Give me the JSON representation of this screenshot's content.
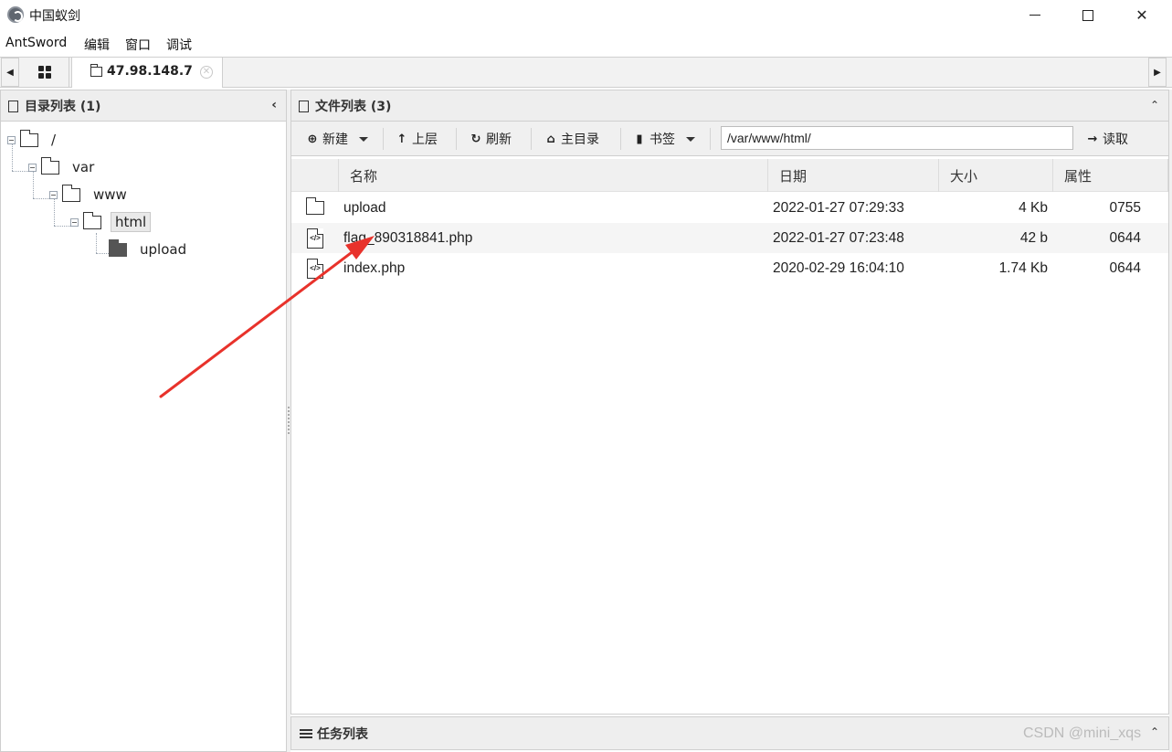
{
  "window": {
    "title": "中国蚁剑",
    "min_glyph": "",
    "close_glyph": "✕"
  },
  "menu": {
    "items": [
      "AntSword",
      "编辑",
      "窗口",
      "调试"
    ]
  },
  "tabs": {
    "left_arrow": "◀",
    "right_arrow": "▶",
    "host_label": "47.98.148.7",
    "host_close": "✕"
  },
  "left_panel": {
    "title": "目录列表 (1)",
    "collapse_glyph": "‹",
    "tree": [
      {
        "label": "/",
        "depth": 0
      },
      {
        "label": "var",
        "depth": 1
      },
      {
        "label": "www",
        "depth": 2
      },
      {
        "label": "html",
        "depth": 3,
        "selected": true
      },
      {
        "label": "upload",
        "depth": 4,
        "filled": true
      }
    ]
  },
  "right_panel": {
    "title": "文件列表 (3)",
    "collapse_glyph": "⌃",
    "toolbar": {
      "new_label": "新建",
      "up_label": "上层",
      "refresh_label": "刷新",
      "home_label": "主目录",
      "bookmark_label": "书签",
      "path_value": "/var/www/html/",
      "read_label": "读取"
    },
    "columns": {
      "name": "名称",
      "date": "日期",
      "size": "大小",
      "attr": "属性"
    },
    "files": [
      {
        "name": "upload",
        "date": "2022-01-27 07:29:33",
        "size": "4 Kb",
        "attr": "0755",
        "type": "dir"
      },
      {
        "name": "flag_890318841.php",
        "date": "2022-01-27 07:23:48",
        "size": "42 b",
        "attr": "0644",
        "type": "file"
      },
      {
        "name": "index.php",
        "date": "2020-02-29 16:04:10",
        "size": "1.74 Kb",
        "attr": "0644",
        "type": "file"
      }
    ]
  },
  "task_panel": {
    "title": "任务列表",
    "collapse_glyph": "⌃"
  },
  "watermark": "CSDN @mini_xqs",
  "annotation": {
    "arrow_color": "#e8322b"
  }
}
